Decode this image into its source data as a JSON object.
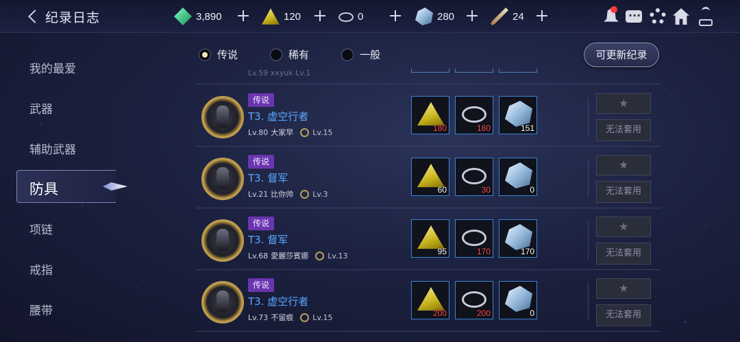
{
  "header": {
    "title": "纪录日志",
    "currencies": [
      {
        "icon": "green-gem-icon",
        "value": "3,890"
      },
      {
        "icon": "yellow-ore-icon",
        "value": "120"
      },
      {
        "icon": "silver-ring-icon",
        "value": "0"
      },
      {
        "icon": "crystal-icon",
        "value": "280"
      },
      {
        "icon": "feather-sword-icon",
        "value": "24"
      }
    ]
  },
  "sidebar": {
    "items": [
      "我的最爱",
      "武器",
      "辅助武器",
      "防具",
      "项链",
      "戒指",
      "腰带"
    ],
    "active_index": 3
  },
  "filters": [
    {
      "label": "传说",
      "selected": true
    },
    {
      "label": "稀有",
      "selected": false
    },
    {
      "label": "一般",
      "selected": false
    }
  ],
  "update_button": "可更新纪录",
  "previous_row_partial": "Lv.59 xxyuk   Lv.1",
  "rows": [
    {
      "grade": "传说",
      "name": "T3. 虚空行者",
      "level": "Lv.80",
      "owner": "大家早",
      "skill": "Lv.15",
      "materials": [
        {
          "type": "yellow-ore",
          "value": "180",
          "color": "#ff4d4d"
        },
        {
          "type": "silver-ring",
          "value": "180",
          "color": "#ff4d4d"
        },
        {
          "type": "crystal",
          "value": "151",
          "color": "#ffffff"
        }
      ],
      "apply_label": "无法套用"
    },
    {
      "grade": "传说",
      "name": "T3. 督军",
      "level": "Lv.21",
      "owner": "比你帅",
      "skill": "Lv.3",
      "materials": [
        {
          "type": "yellow-ore",
          "value": "60",
          "color": "#ffffff"
        },
        {
          "type": "silver-ring",
          "value": "30",
          "color": "#ff4d4d"
        },
        {
          "type": "crystal",
          "value": "0",
          "color": "#ffffff"
        }
      ],
      "apply_label": "无法套用"
    },
    {
      "grade": "传说",
      "name": "T3. 督军",
      "level": "Lv.68",
      "owner": "愛麗莎賓娜",
      "skill": "Lv.13",
      "materials": [
        {
          "type": "yellow-ore",
          "value": "95",
          "color": "#ffffff"
        },
        {
          "type": "silver-ring",
          "value": "170",
          "color": "#ff4d4d"
        },
        {
          "type": "crystal",
          "value": "170",
          "color": "#ffffff"
        }
      ],
      "apply_label": "无法套用"
    },
    {
      "grade": "传说",
      "name": "T3. 虚空行者",
      "level": "Lv.73",
      "owner": "不留痕",
      "skill": "Lv.15",
      "materials": [
        {
          "type": "yellow-ore",
          "value": "200",
          "color": "#ff4d4d"
        },
        {
          "type": "silver-ring",
          "value": "200",
          "color": "#ff4d4d"
        },
        {
          "type": "crystal",
          "value": "0",
          "color": "#ffffff"
        }
      ],
      "apply_label": "无法套用"
    }
  ]
}
